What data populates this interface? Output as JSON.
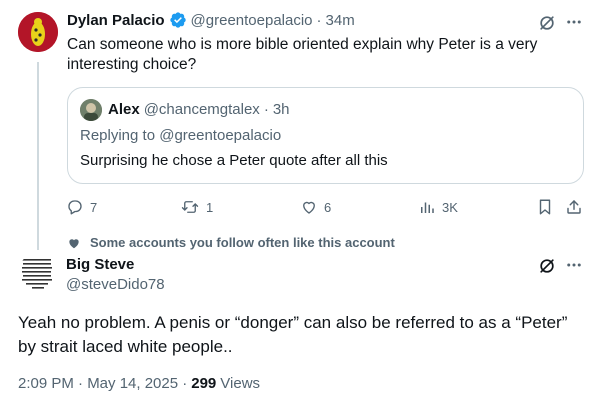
{
  "tweet1": {
    "name": "Dylan Palacio",
    "handle": "@greentoepalacio",
    "time": "34m",
    "text": "Can someone who is more bible oriented explain why Peter is a very interesting choice?",
    "quote": {
      "name": "Alex",
      "handle": "@chancemgtalex",
      "time": "3h",
      "replying_to": "Replying to @greentoepalacio",
      "text": "Surprising he chose a Peter quote after all this"
    },
    "actions": {
      "replies": "7",
      "reposts": "1",
      "likes": "6",
      "views": "3K"
    }
  },
  "social_context": "Some accounts you follow often like this account",
  "tweet2": {
    "name": "Big Steve",
    "handle": "@steveDido78",
    "text": "Yeah no problem.  A penis or “donger” can also be referred to as a “Peter” by strait laced white people..",
    "timestamp": "2:09 PM · May 14, 2025 ·",
    "views_count": "299",
    "views_label": "Views"
  },
  "colors": {
    "verified": "#1d9bf0",
    "muted": "#536471",
    "border": "#cfd9de"
  }
}
